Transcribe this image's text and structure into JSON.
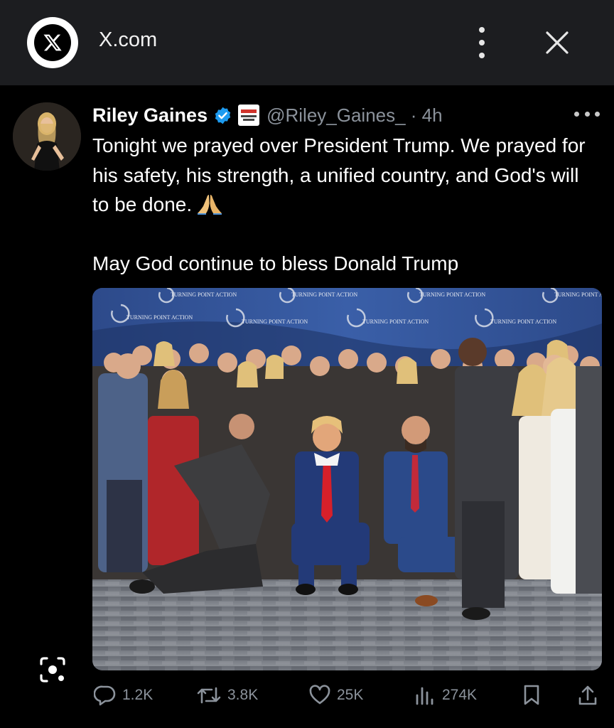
{
  "app": {
    "title": "X.com",
    "logo_icon": "x-logo-icon",
    "menu_icon": "more-vertical-icon",
    "close_icon": "close-icon"
  },
  "post": {
    "author_name": "Riley Gaines",
    "verified_icon": "verified-badge-icon",
    "affiliation_badge_icon": "affiliation-badge-icon",
    "handle_time": "@Riley_Gaines_ · 4h",
    "more_icon": "more-horizontal-icon",
    "text_line1": "Tonight we prayed over President Trump. We prayed for his safety, his strength, a unified country, and God's will to be done.",
    "text_emoji": "🙏",
    "text_line2": "May God continue to bless Donald Trump",
    "media_banner_text": "TURNING POINT ACTION"
  },
  "actions": {
    "reply_count": "1.2K",
    "repost_count": "3.8K",
    "like_count": "25K",
    "views_count": "274K",
    "bookmark_icon": "bookmark-icon",
    "share_icon": "share-icon"
  },
  "colors": {
    "appbar_bg": "#1c1d20",
    "background": "#000000",
    "text_primary": "#ffffff",
    "text_secondary": "#8b929b",
    "verified_blue": "#1d9bf0"
  }
}
